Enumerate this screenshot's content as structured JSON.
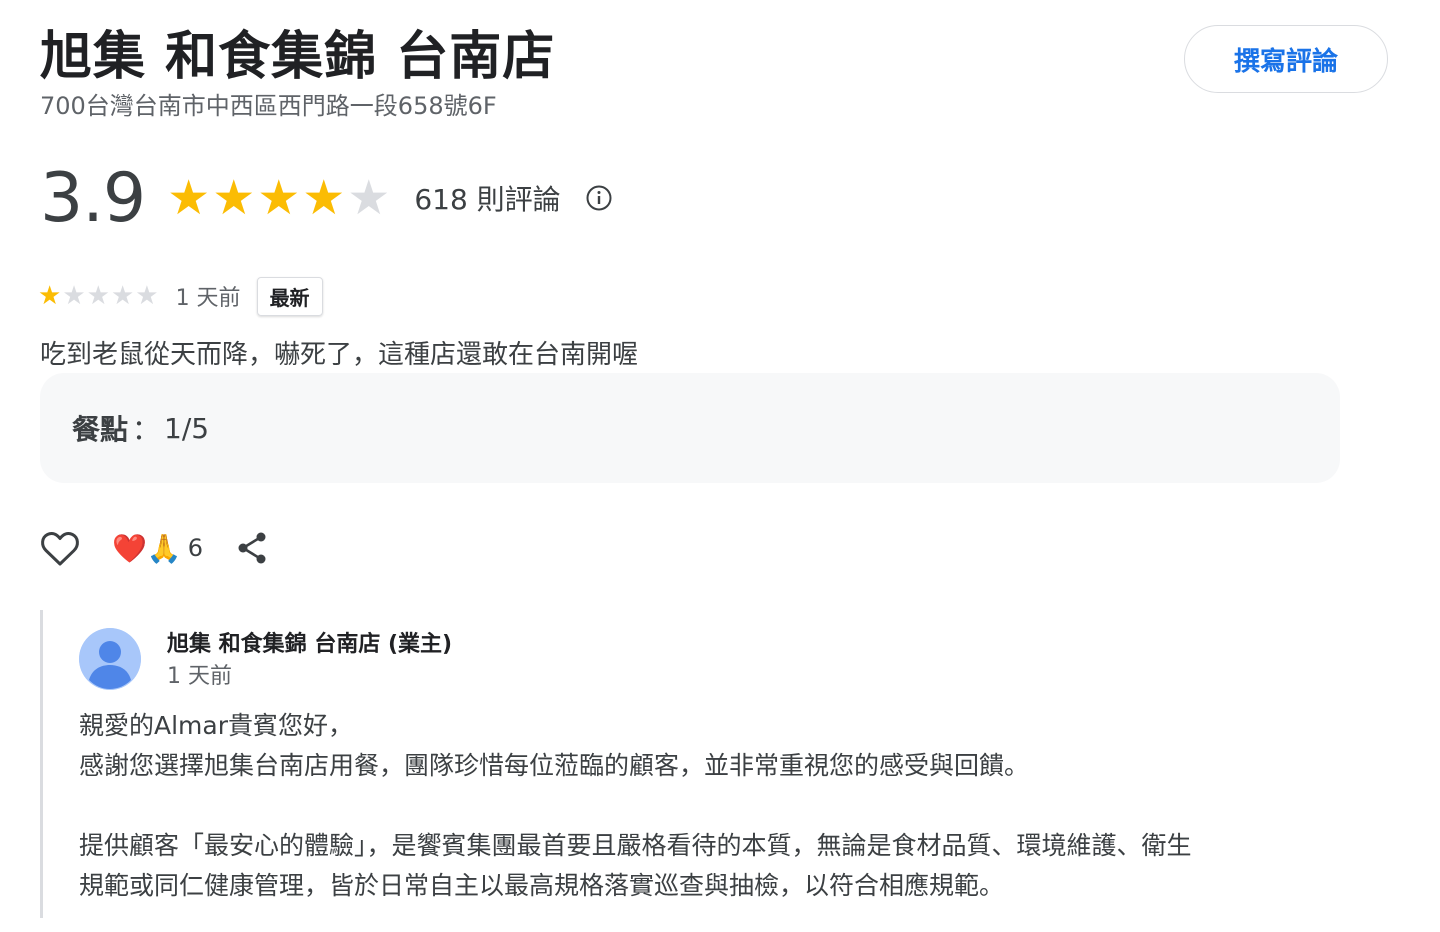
{
  "place": {
    "name": "旭集 和食集錦 台南店",
    "address": "700台灣台南市中西區西門路一段658號6F",
    "write_review_label": "撰寫評論",
    "rating": "3.9",
    "rating_stars": 4,
    "review_count_label": "618 則評論",
    "info_icon": "info-icon"
  },
  "review": {
    "stars": 1,
    "date": "1 天前",
    "badge": "最新",
    "text": "吃到老鼠從天而降，嚇死了，這種店還敢在台南開喔",
    "attribute": {
      "label": "餐點",
      "separator": "：",
      "value": "1/5"
    },
    "reactions": {
      "emoji": "❤️🙏",
      "count": "6"
    },
    "icons": {
      "like": "heart-outline-icon",
      "share": "share-icon",
      "star_filled_color": "#fbbc04",
      "star_empty_color": "#dadce0"
    }
  },
  "owner_response": {
    "name": "旭集 和食集錦 台南店 (業主)",
    "date": "1 天前",
    "avatar": "person-avatar-icon",
    "lines": [
      "親愛的Almar貴賓您好，",
      "感謝您選擇旭集台南店用餐，團隊珍惜每位蒞臨的顧客，並非常重視您的感受與回饋。",
      "提供顧客「最安心的體驗」，是饗賓集團最首要且嚴格看待的本質，無論是食材品質、環境維護、衛生",
      "規範或同仁健康管理，皆於日常自主以最高規格落實巡查與抽檢，以符合相應規範。"
    ]
  }
}
